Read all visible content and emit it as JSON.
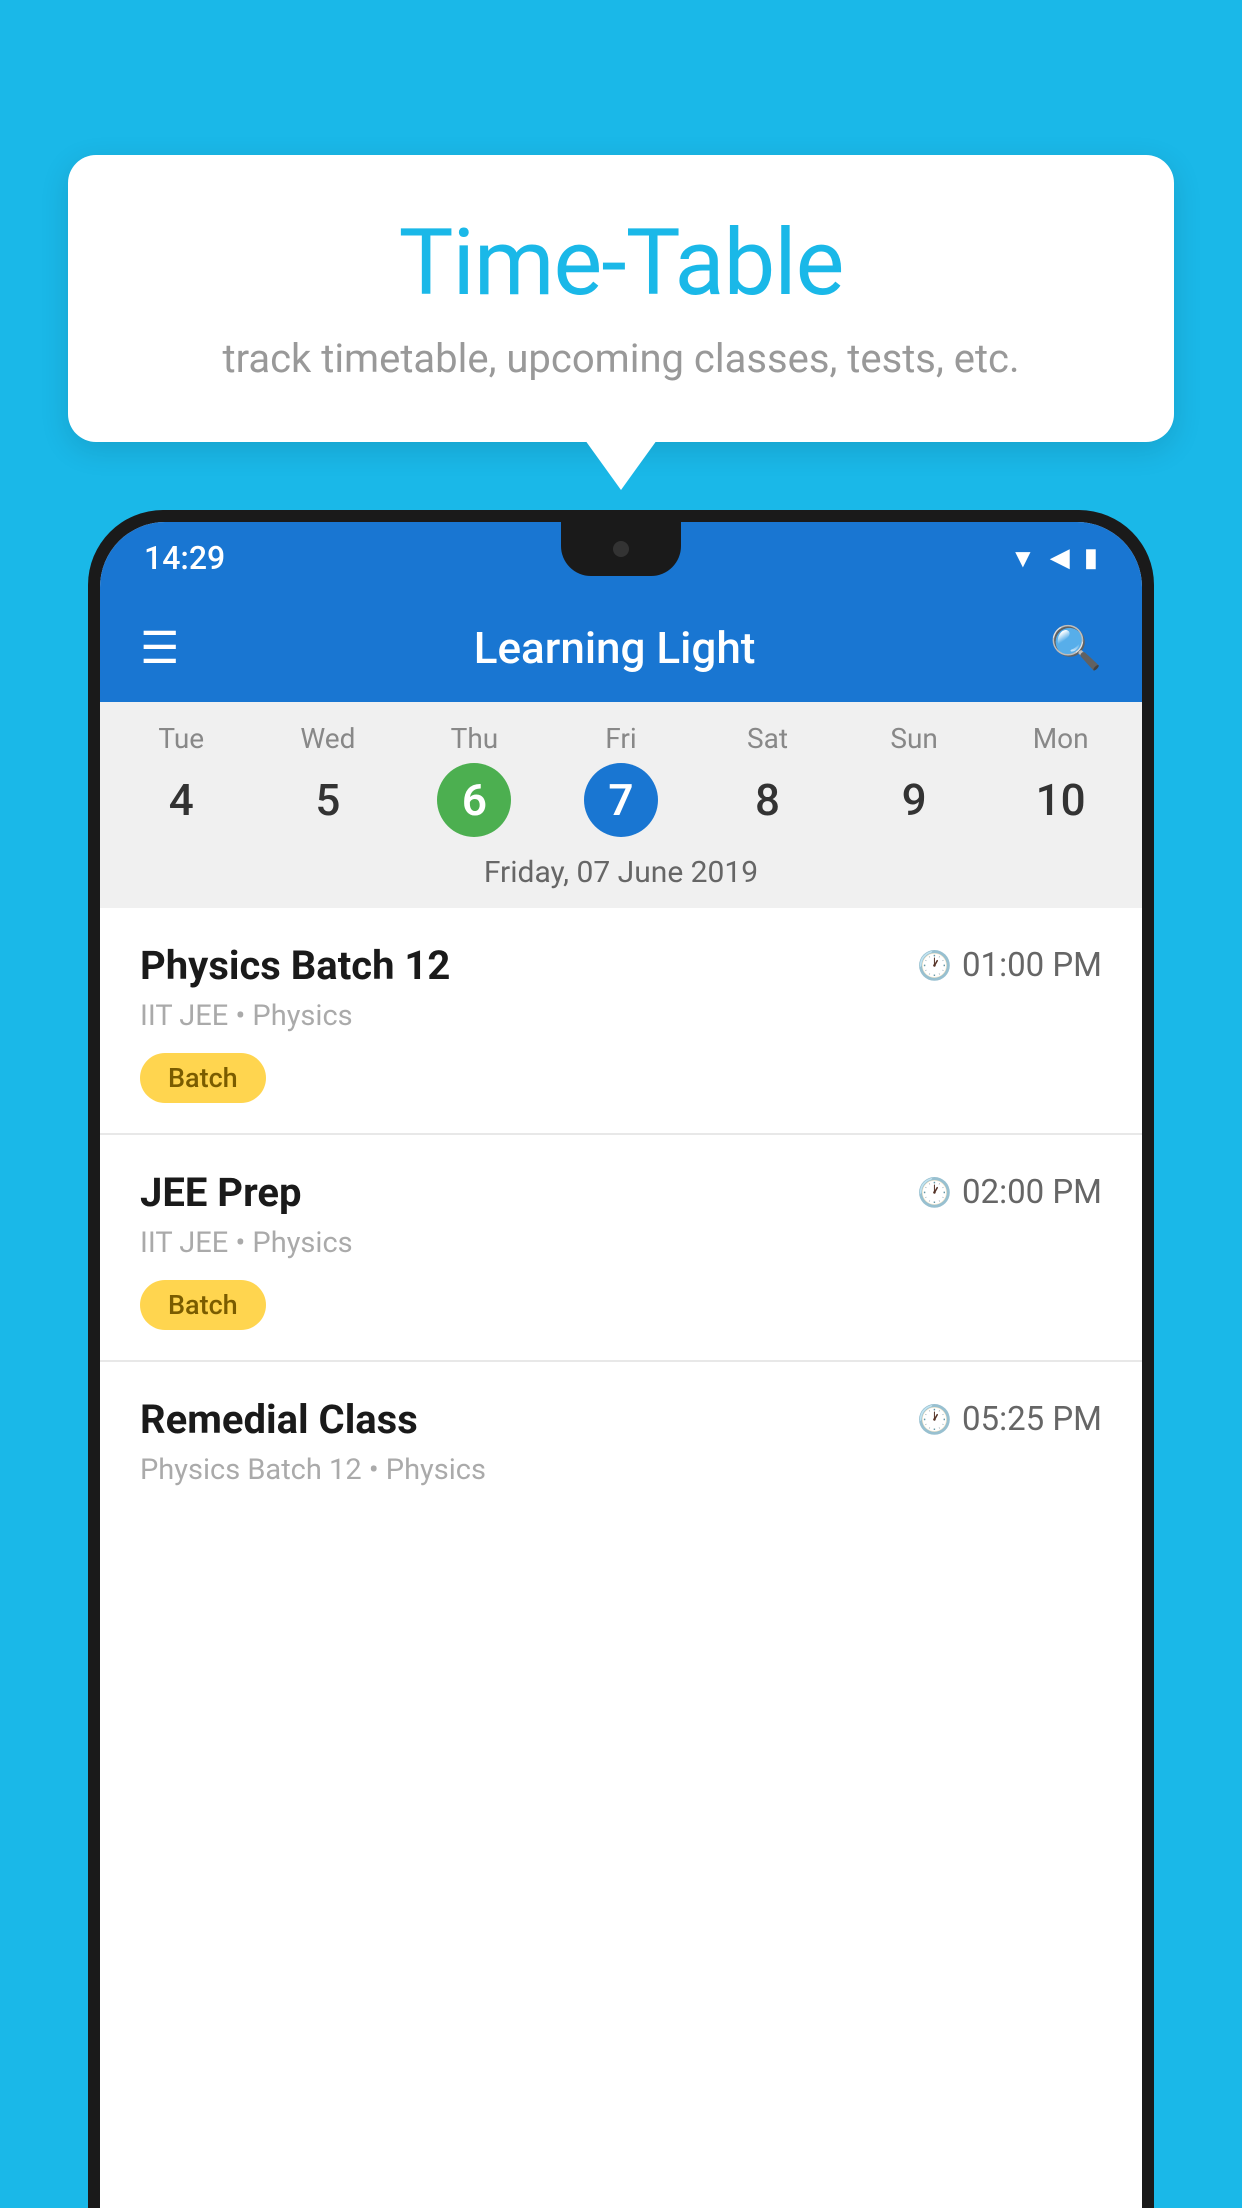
{
  "background_color": "#1ab8e8",
  "speech_bubble": {
    "title": "Time-Table",
    "subtitle": "track timetable, upcoming classes, tests, etc."
  },
  "status_bar": {
    "time": "14:29",
    "color": "#1976d2"
  },
  "app_bar": {
    "title": "Learning Light",
    "color": "#1976d2"
  },
  "calendar": {
    "selected_date_label": "Friday, 07 June 2019",
    "days": [
      {
        "label": "Tue",
        "number": "4",
        "state": "normal"
      },
      {
        "label": "Wed",
        "number": "5",
        "state": "normal"
      },
      {
        "label": "Thu",
        "number": "6",
        "state": "today"
      },
      {
        "label": "Fri",
        "number": "7",
        "state": "selected"
      },
      {
        "label": "Sat",
        "number": "8",
        "state": "normal"
      },
      {
        "label": "Sun",
        "number": "9",
        "state": "normal"
      },
      {
        "label": "Mon",
        "number": "10",
        "state": "normal"
      }
    ]
  },
  "schedule_items": [
    {
      "title": "Physics Batch 12",
      "time": "01:00 PM",
      "subtitle": "IIT JEE • Physics",
      "badge": "Batch"
    },
    {
      "title": "JEE Prep",
      "time": "02:00 PM",
      "subtitle": "IIT JEE • Physics",
      "badge": "Batch"
    },
    {
      "title": "Remedial Class",
      "time": "05:25 PM",
      "subtitle": "Physics Batch 12 • Physics",
      "badge": null
    }
  ],
  "icons": {
    "hamburger": "≡",
    "search": "🔍",
    "clock": "🕐",
    "wifi": "▼",
    "signal": "◀",
    "battery": "▮"
  }
}
